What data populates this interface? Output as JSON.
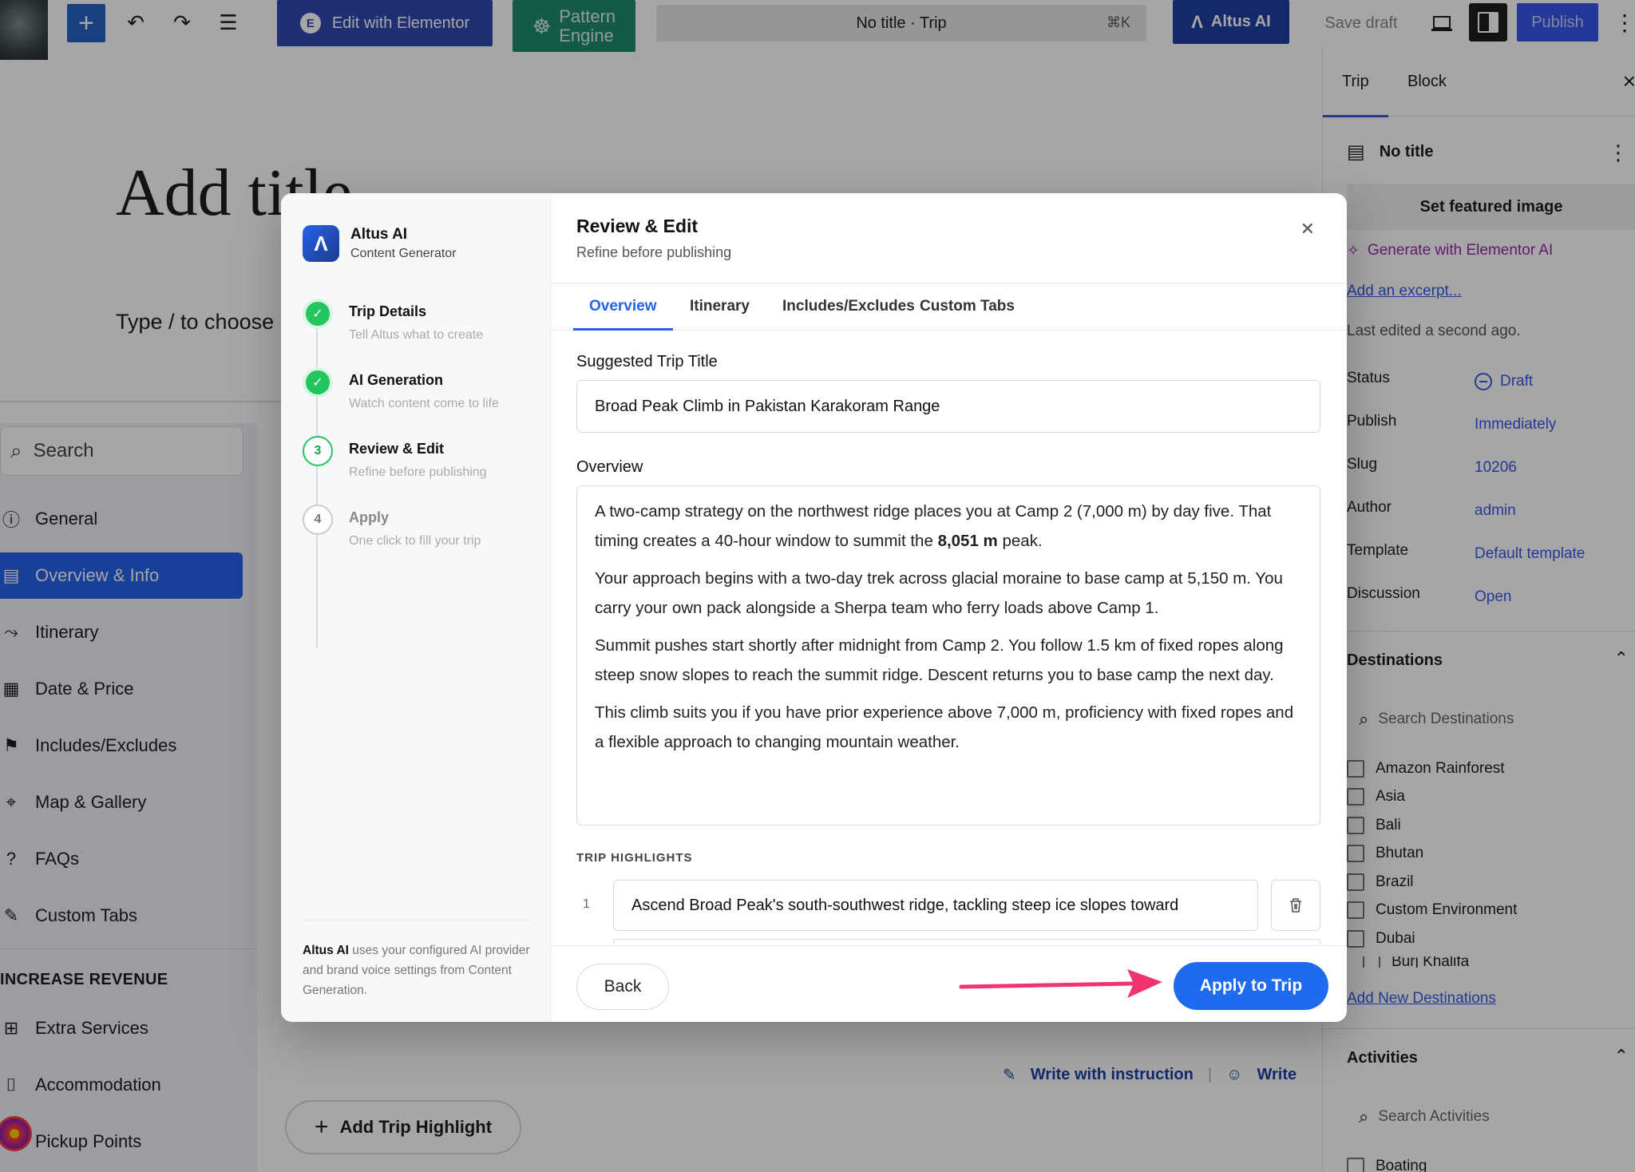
{
  "topbar": {
    "elementor_label": "Edit with Elementor",
    "pattern_label_1": "Pattern",
    "pattern_label_2": "Engine",
    "command_title": "No title · Trip",
    "command_shortcut": "⌘K",
    "altus_label": "Altus AI",
    "save_draft": "Save draft",
    "publish": "Publish"
  },
  "canvas": {
    "title_placeholder": "Add title",
    "block_hint": "Type / to choose a block",
    "write_with_instruction": "Write with instruction",
    "write": "Write",
    "add_highlight": "Add Trip Highlight"
  },
  "tripnav": {
    "search_placeholder": "Search",
    "items": [
      {
        "label": "General",
        "icon": "info-icon"
      },
      {
        "label": "Overview & Info",
        "icon": "document-icon"
      },
      {
        "label": "Itinerary",
        "icon": "route-icon"
      },
      {
        "label": "Date & Price",
        "icon": "calendar-icon"
      },
      {
        "label": "Includes/Excludes",
        "icon": "flag-icon"
      },
      {
        "label": "Map & Gallery",
        "icon": "map-pin-icon"
      },
      {
        "label": "FAQs",
        "icon": "question-icon"
      },
      {
        "label": "Custom Tabs",
        "icon": "wrench-icon"
      }
    ],
    "revenue_heading": "INCREASE REVENUE",
    "revenue_items": [
      {
        "label": "Extra Services",
        "icon": "grid-icon"
      },
      {
        "label": "Accommodation",
        "icon": "bed-icon"
      },
      {
        "label": "Pickup Points",
        "icon": "pin-icon"
      }
    ]
  },
  "sidebar": {
    "tab_trip": "Trip",
    "tab_block": "Block",
    "doc_title": "No title",
    "featured_image": "Set featured image",
    "generate_ai": "Generate with Elementor AI",
    "excerpt": "Add an excerpt...",
    "last_edited": "Last edited a second ago.",
    "meta": [
      {
        "label": "Status",
        "value": "Draft"
      },
      {
        "label": "Publish",
        "value": "Immediately"
      },
      {
        "label": "Slug",
        "value": "10206"
      },
      {
        "label": "Author",
        "value": "admin"
      },
      {
        "label": "Template",
        "value": "Default template"
      },
      {
        "label": "Discussion",
        "value": "Open"
      }
    ],
    "destinations_title": "Destinations",
    "destinations_search": "Search Destinations",
    "destinations": [
      "Amazon Rainforest",
      "Asia",
      "Bali",
      "Bhutan",
      "Brazil",
      "Custom Environment",
      "Dubai",
      "Burj Khalifa"
    ],
    "add_destination": "Add New Destinations",
    "activities_title": "Activities",
    "activities_search": "Search Activities",
    "activities": [
      "Boating"
    ]
  },
  "modal": {
    "brand_name": "Altus AI",
    "brand_sub": "Content Generator",
    "steps": [
      {
        "num": "✓",
        "title": "Trip Details",
        "sub": "Tell Altus what to create"
      },
      {
        "num": "✓",
        "title": "AI Generation",
        "sub": "Watch content come to life"
      },
      {
        "num": "3",
        "title": "Review & Edit",
        "sub": "Refine before publishing"
      },
      {
        "num": "4",
        "title": "Apply",
        "sub": "One click to fill your trip"
      }
    ],
    "note_brand": "Altus AI",
    "note_text": " uses your configured AI provider and brand voice settings from Content Generation.",
    "title": "Review & Edit",
    "subtitle": "Refine before publishing",
    "tabs": [
      "Overview",
      "Itinerary",
      "Includes/Excludes",
      "Custom Tabs"
    ],
    "suggested_title_label": "Suggested Trip Title",
    "suggested_title": "Broad Peak Climb in Pakistan Karakoram Range",
    "overview_label": "Overview",
    "overview_p1_a": "A two-camp strategy on the northwest ridge places you at Camp 2 (7,000 m) by day five. That timing creates a 40-hour window to summit the ",
    "overview_p1_b": "8,051 m",
    "overview_p1_c": " peak.",
    "overview_p2": "Your approach begins with a two-day trek across glacial moraine to base camp at 5,150 m. You carry your own pack alongside a Sherpa team who ferry loads above Camp 1.",
    "overview_p3": "Summit pushes start shortly after midnight from Camp 2. You follow 1.5 km of fixed ropes along steep snow slopes to reach the summit ridge. Descent returns you to base camp the next day.",
    "overview_p4": "This climb suits you if you have prior experience above 7,000 m, proficiency with fixed ropes and a flexible approach to changing mountain weather.",
    "highlights_label": "TRIP HIGHLIGHTS",
    "highlight_num": "1",
    "highlight_1": "Ascend Broad Peak's south-southwest ridge, tackling steep ice slopes toward",
    "back": "Back",
    "apply": "Apply to Trip"
  },
  "colors": {
    "accent": "#2563eb",
    "apply": "#1f6bf0",
    "success": "#22c55e",
    "arrow": "#f0346e"
  }
}
